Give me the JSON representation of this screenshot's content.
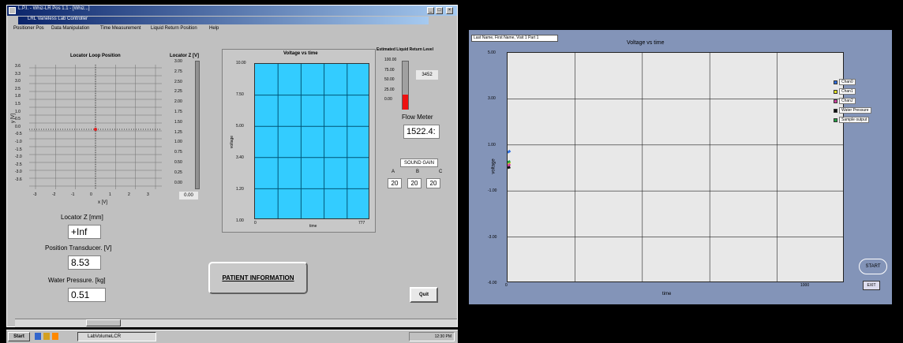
{
  "left_window": {
    "title": "L.P.I. - Whiz-LR Pos 1.1 - [Whiz...]",
    "inner_title": "LRL Vaneless Lab Controller",
    "window_buttons": [
      "_",
      "□",
      "×"
    ],
    "menu": [
      "Positioner Pos",
      "Data Manipulation",
      "Time Measurement",
      "Liquid Return Position",
      "Help"
    ]
  },
  "locator_loop": {
    "title": "Locator Loop Position",
    "y_label": "y [V]",
    "x_label": "x [V]",
    "y_ticks": [
      "3.6",
      "3.3",
      "3.0",
      "2.5",
      "1.8",
      "1.5",
      "1.0",
      "0.5",
      "0.0",
      "-0.5",
      "-1.0",
      "-1.5",
      "-2.0",
      "-2.5",
      "-3.0",
      "-3.6"
    ],
    "x_ticks": [
      "-3",
      "-2",
      "-1",
      "0",
      "1",
      "2",
      "3"
    ]
  },
  "locator_z_bar": {
    "title": "Locator Z [V]",
    "ticks": [
      "3.00",
      "2.75",
      "2.50",
      "2.25",
      "2.00",
      "1.75",
      "1.50",
      "1.25",
      "1.00",
      "0.75",
      "0.50",
      "0.25",
      "0.00"
    ],
    "readout": "0.00"
  },
  "voltage_chart": {
    "title": "Voltage vs time",
    "ylabel": "voltage",
    "xlabel": "time",
    "y_ticks": [
      "10.00",
      "7.50",
      "5.00",
      "3.40",
      "1.20",
      "1.00"
    ],
    "x_ticks": [
      "0",
      "777"
    ]
  },
  "liquid_return": {
    "title": "Estimated Liquid Return Level",
    "ticks": [
      "100.00",
      "75.00",
      "50.00",
      "25.00",
      "0.00"
    ],
    "readout": "3452",
    "fill_fraction": 0.3
  },
  "flow_meter": {
    "label": "Flow Meter",
    "value": "1522.4:"
  },
  "sound_gain": {
    "label": "SOUND GAIN",
    "headers": [
      "A",
      "B",
      "C"
    ],
    "values": [
      "20",
      "20",
      "20"
    ]
  },
  "locator_z_mm": {
    "label": "Locator Z [mm]",
    "value": "+Inf"
  },
  "position_transducer": {
    "label": "Position Transducer. [V]",
    "value": "8.53"
  },
  "water_pressure": {
    "label": "Water Pressure. [kg]",
    "value": "0.51"
  },
  "patient_info_button": "PATIENT INFORMATION",
  "quit_button": "Quit",
  "taskbar": {
    "start": "Start",
    "task": "LabVolumeLCR",
    "clock": "12:30 PM"
  },
  "right_window": {
    "title_box": "Last Name, First Name, Visit 1 Part 1",
    "chart_title": "Voltage vs time",
    "start_button": "START",
    "exit_button": "EXIT"
  },
  "chart_data": {
    "type": "line",
    "title": "Voltage vs time",
    "xlabel": "time",
    "ylabel": "voltage",
    "xlim": [
      0,
      1000
    ],
    "ylim": [
      -6,
      6
    ],
    "y_ticks": [
      "5.00",
      "3.00",
      "1.00",
      "-1.00",
      "-3.00",
      "-6.00"
    ],
    "x_ticks": [
      "0",
      "1000"
    ],
    "grid": true,
    "legend_position": "right",
    "series": [
      {
        "name": "Chan0",
        "color": "#2f6fe0",
        "x": [
          0,
          8
        ],
        "y": [
          0.8,
          0.9
        ]
      },
      {
        "name": "Chan1",
        "color": "#e0e020",
        "x": [
          0,
          8
        ],
        "y": [
          0.2,
          0.3
        ]
      },
      {
        "name": "Chan2",
        "color": "#d040a0",
        "x": [
          0,
          8
        ],
        "y": [
          0.1,
          0.2
        ]
      },
      {
        "name": "Water Pressure",
        "color": "#111111",
        "x": [
          0,
          8
        ],
        "y": [
          0.0,
          0.05
        ]
      },
      {
        "name": "Sample output",
        "color": "#20a040",
        "x": [
          0,
          8
        ],
        "y": [
          0.3,
          0.35
        ]
      }
    ]
  }
}
